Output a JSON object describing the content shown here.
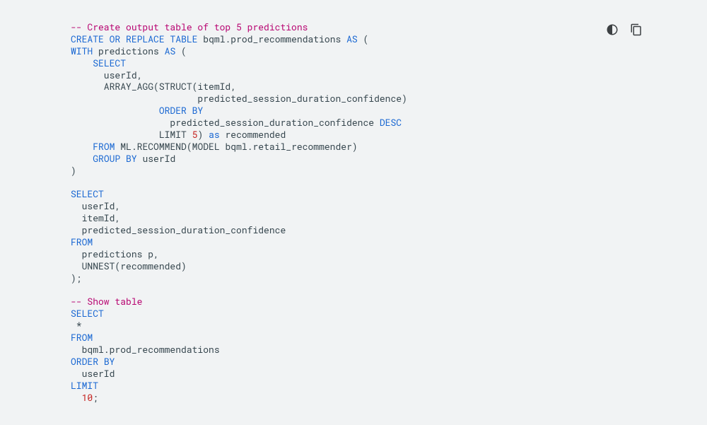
{
  "code": {
    "lines": [
      {
        "segments": [
          {
            "type": "comment",
            "text": "-- Create output table of top 5 predictions"
          }
        ]
      },
      {
        "segments": [
          {
            "type": "keyword",
            "text": "CREATE"
          },
          {
            "type": "plain",
            "text": " "
          },
          {
            "type": "keyword",
            "text": "OR"
          },
          {
            "type": "plain",
            "text": " "
          },
          {
            "type": "keyword",
            "text": "REPLACE"
          },
          {
            "type": "plain",
            "text": " "
          },
          {
            "type": "keyword",
            "text": "TABLE"
          },
          {
            "type": "plain",
            "text": " bqml.prod_recommendations "
          },
          {
            "type": "keyword",
            "text": "AS"
          },
          {
            "type": "plain",
            "text": " ("
          }
        ]
      },
      {
        "segments": [
          {
            "type": "keyword",
            "text": "WITH"
          },
          {
            "type": "plain",
            "text": " predictions "
          },
          {
            "type": "keyword",
            "text": "AS"
          },
          {
            "type": "plain",
            "text": " ("
          }
        ]
      },
      {
        "segments": [
          {
            "type": "plain",
            "text": "    "
          },
          {
            "type": "keyword",
            "text": "SELECT"
          }
        ]
      },
      {
        "segments": [
          {
            "type": "plain",
            "text": "      userId,"
          }
        ]
      },
      {
        "segments": [
          {
            "type": "plain",
            "text": "      ARRAY_AGG(STRUCT(itemId,"
          }
        ]
      },
      {
        "segments": [
          {
            "type": "plain",
            "text": "                       predicted_session_duration_confidence)"
          }
        ]
      },
      {
        "segments": [
          {
            "type": "plain",
            "text": "                "
          },
          {
            "type": "keyword",
            "text": "ORDER"
          },
          {
            "type": "plain",
            "text": " "
          },
          {
            "type": "keyword",
            "text": "BY"
          }
        ]
      },
      {
        "segments": [
          {
            "type": "plain",
            "text": "                  predicted_session_duration_confidence "
          },
          {
            "type": "keyword",
            "text": "DESC"
          }
        ]
      },
      {
        "segments": [
          {
            "type": "plain",
            "text": "                LIMIT "
          },
          {
            "type": "number",
            "text": "5"
          },
          {
            "type": "plain",
            "text": ") "
          },
          {
            "type": "keyword",
            "text": "as"
          },
          {
            "type": "plain",
            "text": " recommended"
          }
        ]
      },
      {
        "segments": [
          {
            "type": "plain",
            "text": "    "
          },
          {
            "type": "keyword",
            "text": "FROM"
          },
          {
            "type": "plain",
            "text": " ML.RECOMMEND(MODEL bqml.retail_recommender)"
          }
        ]
      },
      {
        "segments": [
          {
            "type": "plain",
            "text": "    "
          },
          {
            "type": "keyword",
            "text": "GROUP"
          },
          {
            "type": "plain",
            "text": " "
          },
          {
            "type": "keyword",
            "text": "BY"
          },
          {
            "type": "plain",
            "text": " userId"
          }
        ]
      },
      {
        "segments": [
          {
            "type": "plain",
            "text": ")"
          }
        ]
      },
      {
        "segments": [
          {
            "type": "plain",
            "text": ""
          }
        ]
      },
      {
        "segments": [
          {
            "type": "keyword",
            "text": "SELECT"
          }
        ]
      },
      {
        "segments": [
          {
            "type": "plain",
            "text": "  userId,"
          }
        ]
      },
      {
        "segments": [
          {
            "type": "plain",
            "text": "  itemId,"
          }
        ]
      },
      {
        "segments": [
          {
            "type": "plain",
            "text": "  predicted_session_duration_confidence"
          }
        ]
      },
      {
        "segments": [
          {
            "type": "keyword",
            "text": "FROM"
          }
        ]
      },
      {
        "segments": [
          {
            "type": "plain",
            "text": "  predictions p,"
          }
        ]
      },
      {
        "segments": [
          {
            "type": "plain",
            "text": "  UNNEST(recommended)"
          }
        ]
      },
      {
        "segments": [
          {
            "type": "plain",
            "text": ");"
          }
        ]
      },
      {
        "segments": [
          {
            "type": "plain",
            "text": ""
          }
        ]
      },
      {
        "segments": [
          {
            "type": "comment",
            "text": "-- Show table"
          }
        ]
      },
      {
        "segments": [
          {
            "type": "keyword",
            "text": "SELECT"
          }
        ]
      },
      {
        "segments": [
          {
            "type": "plain",
            "text": " *"
          }
        ]
      },
      {
        "segments": [
          {
            "type": "keyword",
            "text": "FROM"
          }
        ]
      },
      {
        "segments": [
          {
            "type": "plain",
            "text": "  bqml.prod_recommendations"
          }
        ]
      },
      {
        "segments": [
          {
            "type": "keyword",
            "text": "ORDER"
          },
          {
            "type": "plain",
            "text": " "
          },
          {
            "type": "keyword",
            "text": "BY"
          }
        ]
      },
      {
        "segments": [
          {
            "type": "plain",
            "text": "  userId"
          }
        ]
      },
      {
        "segments": [
          {
            "type": "keyword",
            "text": "LIMIT"
          }
        ]
      },
      {
        "segments": [
          {
            "type": "plain",
            "text": "  "
          },
          {
            "type": "number",
            "text": "10"
          },
          {
            "type": "plain",
            "text": ";"
          }
        ]
      }
    ]
  },
  "icons": {
    "theme": "theme-toggle-icon",
    "copy": "copy-icon"
  }
}
